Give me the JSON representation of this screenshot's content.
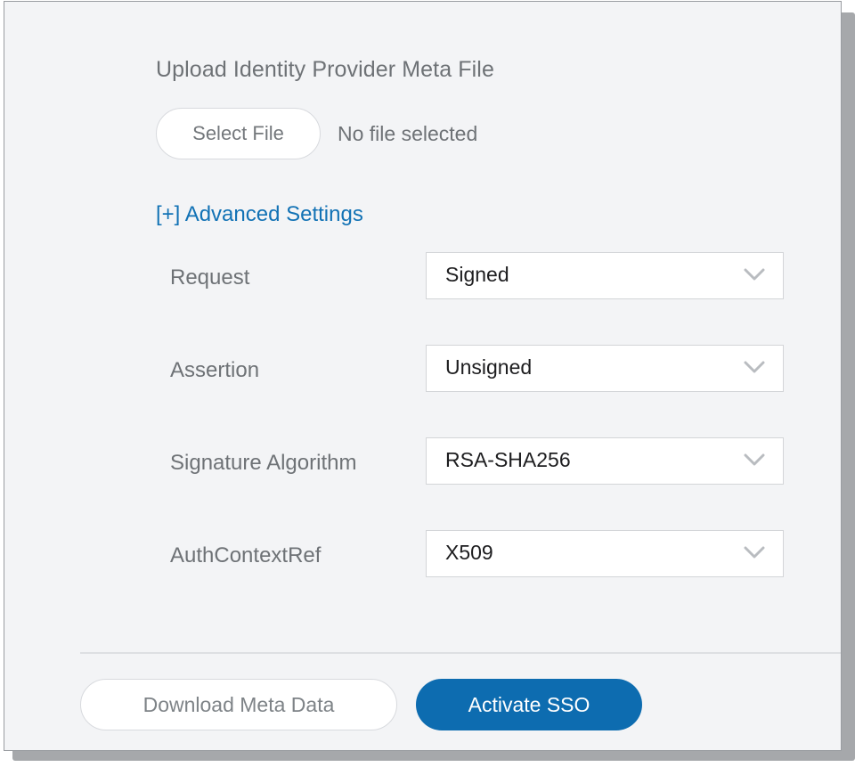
{
  "panel": {
    "background_color": "#f3f4f6",
    "border_color": "#9a9da1",
    "shadow_color": "#a6a8ab"
  },
  "upload": {
    "title": "Upload Identity Provider Meta File",
    "select_file_label": "Select File",
    "file_status": "No file selected"
  },
  "advanced": {
    "link_label": "[+] Advanced Settings",
    "link_color": "#1272b5"
  },
  "settings": {
    "rows": [
      {
        "label": "Request",
        "value": "Signed",
        "icon": "chevron-down-icon"
      },
      {
        "label": "Assertion",
        "value": "Unsigned",
        "icon": "chevron-down-icon"
      },
      {
        "label": "Signature Algorithm",
        "value": "RSA-SHA256",
        "icon": "chevron-down-icon"
      },
      {
        "label": "AuthContextRef",
        "value": "X509",
        "icon": "chevron-down-icon"
      }
    ]
  },
  "footer": {
    "download_label": "Download Meta Data",
    "activate_label": "Activate SSO",
    "activate_color": "#0d6cb0",
    "divider_color": "#dddfe2"
  }
}
